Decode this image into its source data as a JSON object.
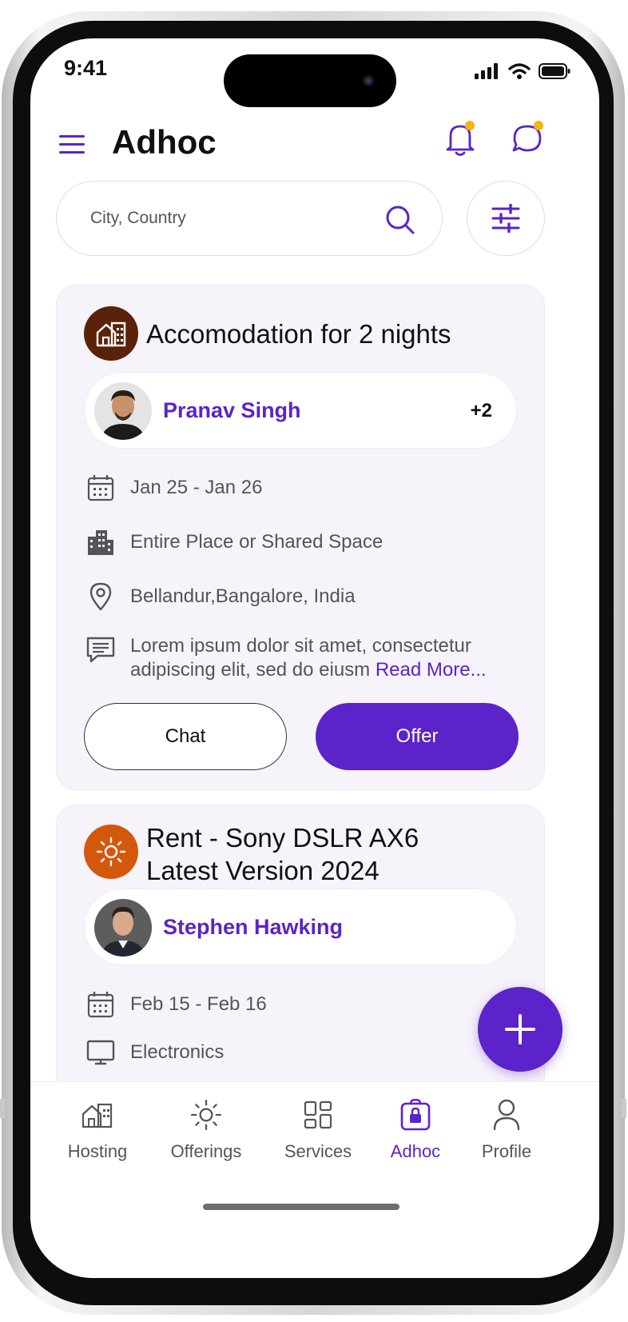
{
  "status": {
    "time": "9:41"
  },
  "header": {
    "title": "Adhoc"
  },
  "search": {
    "placeholder": "City, Country"
  },
  "listings": [
    {
      "title": "Accomodation for 2 nights",
      "category_icon": "home-building-icon",
      "category_color": "#5a2208",
      "person": {
        "name": "Pranav Singh",
        "extra": "+2"
      },
      "dates": "Jan 25 - Jan 26",
      "space": "Entire Place or Shared Space",
      "location": "Bellandur,Bangalore, India",
      "description": "Lorem ipsum dolor sit amet, consectetur adipiscing elit, sed do eiusm",
      "read_more": "Read More...",
      "chat_label": "Chat",
      "offer_label": "Offer"
    },
    {
      "title_line1": "Rent - Sony DSLR AX6",
      "title_line2": "Latest Version 2024",
      "category_icon": "sun-icon",
      "category_color": "#d4580c",
      "person": {
        "name": "Stephen Hawking"
      },
      "dates": "Feb 15 - Feb 16",
      "category": "Electronics"
    }
  ],
  "fab": {
    "icon": "plus-icon"
  },
  "tabs": [
    {
      "label": "Hosting",
      "icon": "home-building-icon"
    },
    {
      "label": "Offerings",
      "icon": "sun-icon"
    },
    {
      "label": "Services",
      "icon": "grid-icon"
    },
    {
      "label": "Adhoc",
      "icon": "lock-bag-icon",
      "active": true
    },
    {
      "label": "Profile",
      "icon": "user-icon"
    }
  ],
  "colors": {
    "accent": "#5b23c9",
    "notification_dot": "#f5b50f"
  }
}
